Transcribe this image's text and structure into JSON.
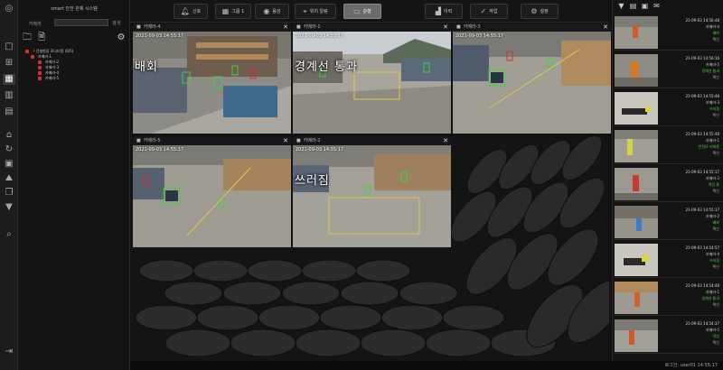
{
  "tree": {
    "title": "smart 안전 관제 시스템",
    "filter_label": "카메라",
    "filter_button": "검색",
    "nodes": [
      {
        "label": "└ 건설현장 모니터링 (0/5)",
        "level": 0
      },
      {
        "label": "카메라-1",
        "level": 1
      },
      {
        "label": "카메라-2",
        "level": 2
      },
      {
        "label": "카메라-3",
        "level": 2
      },
      {
        "label": "카메라-4",
        "level": 2
      },
      {
        "label": "카메라-5",
        "level": 2
      }
    ]
  },
  "toolbar": {
    "buttons": [
      {
        "label": "신호",
        "icon": "bell-icon"
      },
      {
        "label": "그룹 1",
        "icon": "grid-icon"
      },
      {
        "label": "음성",
        "icon": "sound-icon"
      },
      {
        "label": "위치 알림",
        "icon": "location-icon"
      },
      {
        "label": "순찰",
        "icon": "monitor-icon",
        "active": true
      },
      {
        "label": "이력",
        "icon": "chart-icon"
      },
      {
        "label": "작업",
        "icon": "check-icon"
      },
      {
        "label": "설정",
        "icon": "gear-icon"
      }
    ]
  },
  "cameras": [
    {
      "title": "카메라-4",
      "timestamp": "2021-09-03 14:55:17",
      "event": "배회"
    },
    {
      "title": "카메라-1",
      "timestamp": "2021-09-03 14:55:17",
      "event": "경계선 통과"
    },
    {
      "title": "카메라-3",
      "timestamp": "2021-09-03 14:55:17",
      "event": ""
    },
    {
      "title": "카메라-5",
      "timestamp": "2021-09-03 14:55:17",
      "event": ""
    },
    {
      "title": "카메라-2",
      "timestamp": "2021-09-03 14:55:17",
      "event": "쓰러짐"
    }
  ],
  "events": [
    {
      "time": "21-09-03 14:56:48",
      "camera": "카메라-4",
      "type": "배회",
      "state": "확인"
    },
    {
      "time": "21-09-03 14:56:16",
      "camera": "카메라-5",
      "type": "경계선 통과",
      "state": "확인"
    },
    {
      "time": "21-09-03 14:55:48",
      "camera": "카메라-3",
      "type": "쓰러짐",
      "state": "확인"
    },
    {
      "time": "21-09-03 14:55:48",
      "camera": "카메라-1",
      "type": "안전모 미착용",
      "state": "확인"
    },
    {
      "time": "21-09-03 14:55:17",
      "camera": "카메라-3",
      "type": "작업 중",
      "state": "확인"
    },
    {
      "time": "21-09-03 14:55:17",
      "camera": "카메라-2",
      "type": "배회",
      "state": "확인"
    },
    {
      "time": "21-09-03 14:54:57",
      "camera": "카메라-4",
      "type": "쓰러짐",
      "state": "확인"
    },
    {
      "time": "21-09-03 14:54:48",
      "camera": "카메라-1",
      "type": "경계선 통과",
      "state": "확인"
    },
    {
      "time": "21-09-03 14:54:37",
      "camera": "카메라-5",
      "type": "작업",
      "state": "확인"
    }
  ],
  "status": {
    "text": "로그인: user01     14:55:17"
  },
  "colors": {
    "accent": "#6b6b6b",
    "alert": "#d62d2d",
    "ok": "#5bd24a",
    "zone": "#e0c84a"
  }
}
